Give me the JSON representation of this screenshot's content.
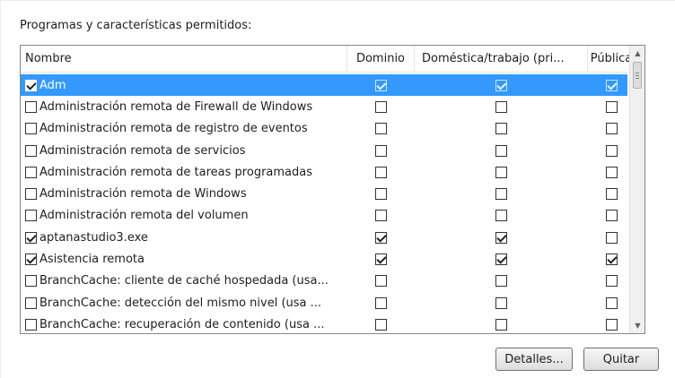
{
  "group_label": "Programas y características permitidos:",
  "columns": {
    "name": "Nombre",
    "domain": "Dominio",
    "home": "Doméstica/trabajo (pri...",
    "public": "Pública"
  },
  "rows": [
    {
      "name": "Adm",
      "enabled": true,
      "domain": true,
      "home": true,
      "public": true,
      "selected": true
    },
    {
      "name": "Administración remota de Firewall de Windows",
      "enabled": false,
      "domain": false,
      "home": false,
      "public": false
    },
    {
      "name": "Administración remota de registro de eventos",
      "enabled": false,
      "domain": false,
      "home": false,
      "public": false
    },
    {
      "name": "Administración remota de servicios",
      "enabled": false,
      "domain": false,
      "home": false,
      "public": false
    },
    {
      "name": "Administración remota de tareas programadas",
      "enabled": false,
      "domain": false,
      "home": false,
      "public": false
    },
    {
      "name": "Administración remota de Windows",
      "enabled": false,
      "domain": false,
      "home": false,
      "public": false
    },
    {
      "name": "Administración remota del volumen",
      "enabled": false,
      "domain": false,
      "home": false,
      "public": false
    },
    {
      "name": "aptanastudio3.exe",
      "enabled": true,
      "domain": true,
      "home": true,
      "public": false
    },
    {
      "name": "Asistencia remota",
      "enabled": true,
      "domain": true,
      "home": true,
      "public": true
    },
    {
      "name": "BranchCache: cliente de caché hospedada (usa...",
      "enabled": false,
      "domain": false,
      "home": false,
      "public": false
    },
    {
      "name": "BranchCache: detección del mismo nivel (usa ...",
      "enabled": false,
      "domain": false,
      "home": false,
      "public": false
    },
    {
      "name": "BranchCache: recuperación de contenido (usa ...",
      "enabled": false,
      "domain": false,
      "home": false,
      "public": false
    }
  ],
  "buttons": {
    "details": "Detalles...",
    "remove": "Quitar"
  },
  "icons": {
    "scroll_up": "scroll-up-arrow-icon",
    "scroll_down": "scroll-down-arrow-icon"
  },
  "colors": {
    "selection": "#3399ff",
    "border": "#828790"
  }
}
